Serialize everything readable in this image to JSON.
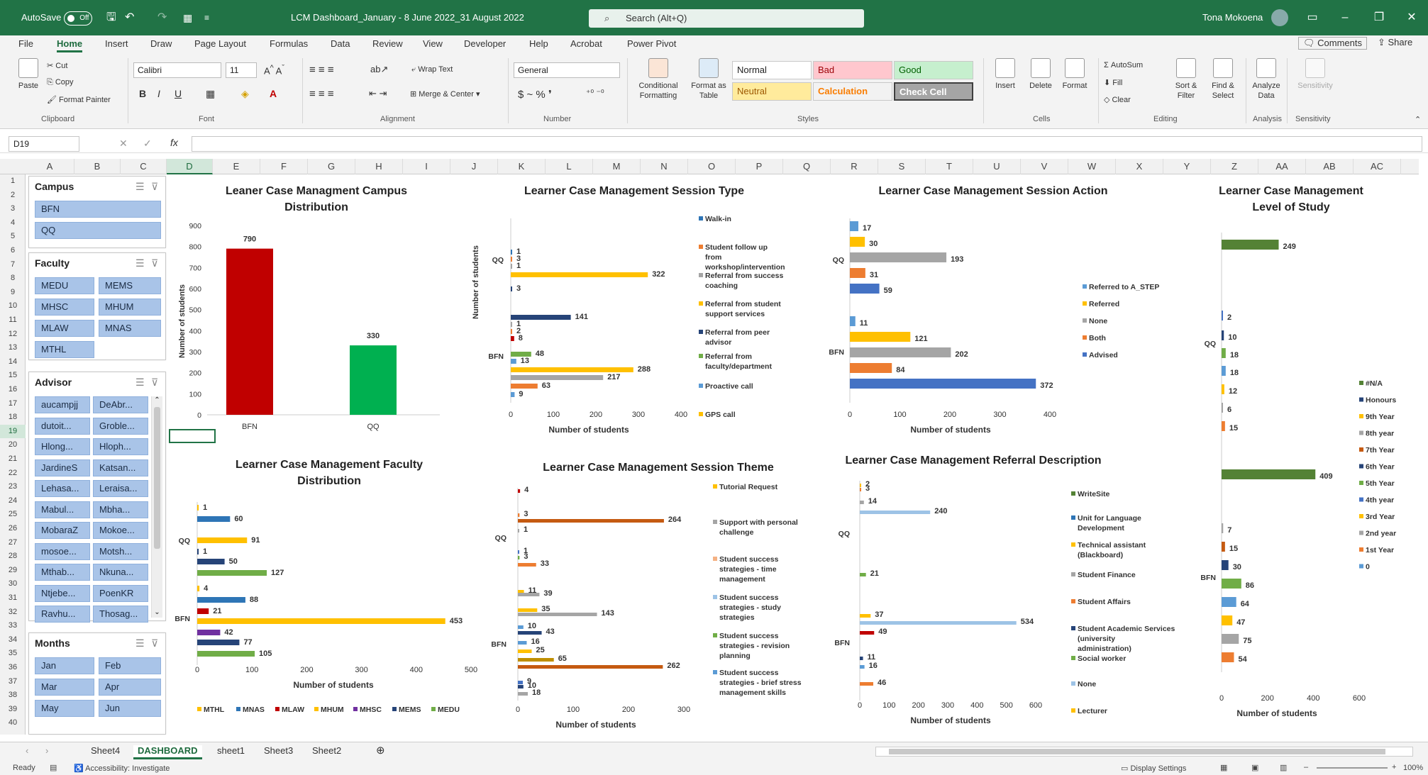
{
  "window": {
    "autosave": "AutoSave",
    "autosave_state": "Off",
    "title": "LCM Dashboard_January - 8 June 2022_31 August 2022",
    "search_placeholder": "Search (Alt+Q)",
    "user": "Tona Mokoena"
  },
  "menu": [
    "File",
    "Home",
    "Insert",
    "Draw",
    "Page Layout",
    "Formulas",
    "Data",
    "Review",
    "View",
    "Developer",
    "Help",
    "Acrobat",
    "Power Pivot"
  ],
  "menu_right": {
    "comments": "Comments",
    "share": "Share"
  },
  "ribbon": {
    "clipboard": {
      "paste": "Paste",
      "cut": "Cut",
      "copy": "Copy",
      "format_painter": "Format Painter",
      "label": "Clipboard"
    },
    "font": {
      "name": "Calibri",
      "size": "11",
      "label": "Font"
    },
    "alignment": {
      "wrap": "Wrap Text",
      "merge": "Merge & Center",
      "label": "Alignment"
    },
    "number": {
      "format": "General",
      "label": "Number"
    },
    "styles": {
      "cond": "Conditional Formatting",
      "fmt_table": "Format as Table",
      "normal": "Normal",
      "bad": "Bad",
      "good": "Good",
      "neutral": "Neutral",
      "calculation": "Calculation",
      "check": "Check Cell",
      "label": "Styles"
    },
    "cells": {
      "insert": "Insert",
      "delete": "Delete",
      "format": "Format",
      "label": "Cells"
    },
    "editing": {
      "autosum": "AutoSum",
      "fill": "Fill",
      "clear": "Clear",
      "sort": "Sort & Filter",
      "find": "Find & Select",
      "label": "Editing"
    },
    "analysis": {
      "analyze": "Analyze Data",
      "label": "Analysis"
    },
    "sensitivity": {
      "btn": "Sensitivity",
      "label": "Sensitivity"
    }
  },
  "namebox": "D19",
  "columns": [
    "A",
    "B",
    "C",
    "D",
    "E",
    "F",
    "G",
    "H",
    "I",
    "J",
    "K",
    "L",
    "M",
    "N",
    "O",
    "P",
    "Q",
    "R",
    "S",
    "T",
    "U",
    "V",
    "W",
    "X",
    "Y",
    "Z",
    "AA",
    "AB",
    "AC"
  ],
  "rows": [
    "1",
    "2",
    "3",
    "4",
    "5",
    "6",
    "7",
    "8",
    "9",
    "10",
    "11",
    "12",
    "13",
    "14",
    "15",
    "16",
    "17",
    "18",
    "19",
    "20",
    "21",
    "22",
    "23",
    "24",
    "25",
    "26",
    "27",
    "28",
    "29",
    "30",
    "31",
    "32",
    "33",
    "34",
    "35",
    "36",
    "37",
    "38",
    "39",
    "40"
  ],
  "slicers": {
    "campus": {
      "title": "Campus",
      "items": [
        "BFN",
        "QQ"
      ]
    },
    "faculty": {
      "title": "Faculty",
      "items": [
        "MEDU",
        "MEMS",
        "MHSC",
        "MHUM",
        "MLAW",
        "MNAS",
        "MTHL"
      ]
    },
    "advisor": {
      "title": "Advisor",
      "items": [
        "aucampjj",
        "DeAbr...",
        "dutoit...",
        "Groble...",
        "Hlong...",
        "Hloph...",
        "JardineS",
        "Katsan...",
        "Lehasa...",
        "Leraisa...",
        "Mabul...",
        "Mbha...",
        "MobaraZ",
        "Mokoe...",
        "mosoe...",
        "Motsh...",
        "Mthab...",
        "Nkuna...",
        "Ntjebe...",
        "PoenKR",
        "Ravhu...",
        "Thosag..."
      ]
    },
    "months": {
      "title": "Months",
      "items": [
        "Jan",
        "Feb",
        "Mar",
        "Apr",
        "May",
        "Jun"
      ]
    }
  },
  "chart_data": [
    {
      "type": "bar",
      "title": "Leaner Case Managment Campus Distribution",
      "ylabel": "Number of students",
      "xlabel": "",
      "ylim": [
        0,
        900
      ],
      "yticks": [
        0,
        100,
        200,
        300,
        400,
        500,
        600,
        700,
        800,
        900
      ],
      "categories": [
        "BFN",
        "QQ"
      ],
      "values": [
        790,
        330
      ],
      "colors": [
        "#c00000",
        "#00b050"
      ]
    },
    {
      "type": "bar",
      "orientation": "horizontal",
      "title": "Learner Case Management Session Type",
      "xlabel": "Number of students",
      "ylabel": "Number of students",
      "xlim": [
        0,
        400
      ],
      "xticks": [
        0,
        100,
        200,
        300,
        400
      ],
      "groups": [
        "QQ",
        "BFN"
      ],
      "series": [
        {
          "name": "Walk-in",
          "color": "#2e75b6",
          "values": [
            1,
            141
          ]
        },
        {
          "name": "Student follow up from workshop/intervention",
          "color": "#ed7d31",
          "values": [
            3,
            8
          ]
        },
        {
          "name": "Referral from success coaching",
          "color": "#a5a5a5",
          "values": [
            1,
            2
          ]
        },
        {
          "name": "Referral from student support services",
          "color": "#ffc000",
          "values": [
            322,
            1
          ]
        },
        {
          "name": "Referral from peer advisor",
          "color": "#264478",
          "values": [
            3,
            1
          ]
        },
        {
          "name": "Referral from faculty/department",
          "color": "#70ad47",
          "values": [
            null,
            48
          ]
        },
        {
          "name": "Proactive call",
          "color": "#5b9bd5",
          "values": [
            null,
            13
          ]
        },
        {
          "name": "GPS call",
          "color": "#ffc000",
          "values": [
            null,
            288
          ]
        }
      ],
      "extra_bars": [
        {
          "v": 217,
          "color": "#a5a5a5"
        },
        {
          "v": 63,
          "color": "#ed7d31"
        },
        {
          "v": 9,
          "color": "#5b9bd5"
        }
      ]
    },
    {
      "type": "bar",
      "orientation": "horizontal",
      "title": "Learner Case Management Session Action",
      "xlabel": "Number of students",
      "xlim": [
        0,
        400
      ],
      "xticks": [
        0,
        100,
        200,
        300,
        400
      ],
      "groups": [
        "QQ",
        "BFN"
      ],
      "series": [
        {
          "name": "Referred to A_STEP",
          "color": "#5b9bd5",
          "values": [
            17,
            11
          ]
        },
        {
          "name": "Referred",
          "color": "#ffc000",
          "values": [
            30,
            121
          ]
        },
        {
          "name": "None",
          "color": "#a5a5a5",
          "values": [
            193,
            202
          ]
        },
        {
          "name": "Both",
          "color": "#ed7d31",
          "values": [
            31,
            84
          ]
        },
        {
          "name": "Advised",
          "color": "#4472c4",
          "values": [
            59,
            372
          ]
        }
      ]
    },
    {
      "type": "bar",
      "orientation": "horizontal",
      "title": "Learner Case Management Level of Study",
      "xlabel": "Number of students",
      "xlim": [
        0,
        600
      ],
      "xticks": [
        0,
        200,
        400,
        600
      ],
      "groups": [
        "QQ",
        "BFN"
      ],
      "legend": [
        "#N/A",
        "Honours",
        "9th Year",
        "8th year",
        "7th Year",
        "6th Year",
        "5th Year",
        "4th year",
        "3rd Year",
        "2nd year",
        "1st Year",
        "0"
      ],
      "qq_values": [
        249,
        2,
        10,
        18,
        18,
        12,
        6,
        15
      ],
      "bfn_values": [
        409,
        7,
        15,
        30,
        86,
        64,
        47,
        75,
        54
      ]
    },
    {
      "type": "bar",
      "orientation": "horizontal",
      "title": "Learner Case Management Faculty Distribution",
      "xlabel": "Number of students",
      "xlim": [
        0,
        500
      ],
      "xticks": [
        0,
        100,
        200,
        300,
        400,
        500
      ],
      "groups": [
        "QQ",
        "BFN"
      ],
      "legend": [
        "MTHL",
        "MNAS",
        "MLAW",
        "MHUM",
        "MHSC",
        "MEMS",
        "MEDU"
      ],
      "qq_values": [
        1,
        60,
        91,
        1,
        50,
        127
      ],
      "bfn_values": [
        4,
        88,
        21,
        453,
        42,
        77,
        105
      ]
    },
    {
      "type": "bar",
      "orientation": "horizontal",
      "title": "Learner Case Management Session Theme",
      "xlabel": "Number of students",
      "xlim": [
        0,
        300
      ],
      "xticks": [
        0,
        100,
        200,
        300
      ],
      "groups": [
        "QQ",
        "BFN"
      ],
      "legend": [
        "Tutorial Request",
        "Support with personal challenge",
        "Student success strategies - time management",
        "Student success strategies - study strategies",
        "Student success strategies - revision planning",
        "Student success strategies - brief stress management skills"
      ],
      "labels": [
        "4",
        "3",
        "264",
        "1",
        "1",
        "3",
        "33",
        "11",
        "39",
        "35",
        "143",
        "10",
        "43",
        "16",
        "25",
        "65",
        "262",
        "9",
        "10",
        "18"
      ]
    },
    {
      "type": "bar",
      "orientation": "horizontal",
      "title": "Learner Case Management Referral Description",
      "xlabel": "Number of students",
      "xlim": [
        0,
        600
      ],
      "xticks": [
        0,
        100,
        200,
        300,
        400,
        500,
        600
      ],
      "groups": [
        "QQ",
        "BFN"
      ],
      "legend": [
        "WriteSite",
        "Unit for Language Development",
        "Technical assistant (Blackboard)",
        "Student Finance",
        "Student Affairs",
        "Student Academic Services (university administration)",
        "Social worker",
        "None",
        "Lecturer"
      ],
      "labels": [
        "2",
        "3",
        "14",
        "240",
        "21",
        "37",
        "534",
        "49",
        "11",
        "16",
        "46"
      ]
    }
  ],
  "sheets": [
    "Sheet4",
    "DASHBOARD",
    "sheet1",
    "Sheet3",
    "Sheet2"
  ],
  "status": {
    "ready": "Ready",
    "accessibility": "Accessibility: Investigate",
    "display": "Display Settings",
    "zoom": "100%"
  }
}
